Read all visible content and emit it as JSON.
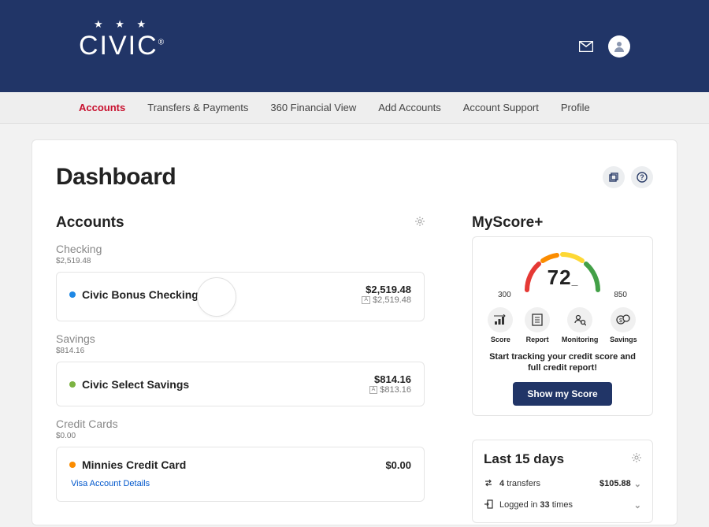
{
  "nav": {
    "items": [
      {
        "label": "Accounts",
        "active": true
      },
      {
        "label": "Transfers & Payments",
        "active": false
      },
      {
        "label": "360 Financial View",
        "active": false
      },
      {
        "label": "Add Accounts",
        "active": false
      },
      {
        "label": "Account Support",
        "active": false
      },
      {
        "label": "Profile",
        "active": false
      }
    ]
  },
  "page": {
    "title": "Dashboard"
  },
  "accounts": {
    "heading": "Accounts",
    "categories": [
      {
        "name": "Checking",
        "total": "$2,519.48",
        "items": [
          {
            "name": "Civic Bonus Checking",
            "balance": "$2,519.48",
            "available": "$2,519.48",
            "dot": "blue",
            "ghost": true
          }
        ]
      },
      {
        "name": "Savings",
        "total": "$814.16",
        "items": [
          {
            "name": "Civic Select Savings",
            "balance": "$814.16",
            "available": "$813.16",
            "dot": "green"
          }
        ]
      },
      {
        "name": "Credit Cards",
        "total": "$0.00",
        "items": [
          {
            "name": "Minnies Credit Card",
            "balance": "$0.00",
            "dot": "orange",
            "sublink": "Visa Account Details"
          }
        ]
      }
    ]
  },
  "score": {
    "heading": "MyScore+",
    "value": "72",
    "min": "300",
    "max": "850",
    "tiles": [
      {
        "label": "Score"
      },
      {
        "label": "Report"
      },
      {
        "label": "Monitoring"
      },
      {
        "label": "Savings"
      }
    ],
    "message": "Start tracking your credit score and full credit report!",
    "button": "Show my Score"
  },
  "last": {
    "title": "Last 15 days",
    "transfers_count": "4",
    "transfers_label": "transfers",
    "transfers_amount": "$105.88",
    "logins_prefix": "Logged in",
    "logins_count": "33",
    "logins_suffix": "times"
  }
}
